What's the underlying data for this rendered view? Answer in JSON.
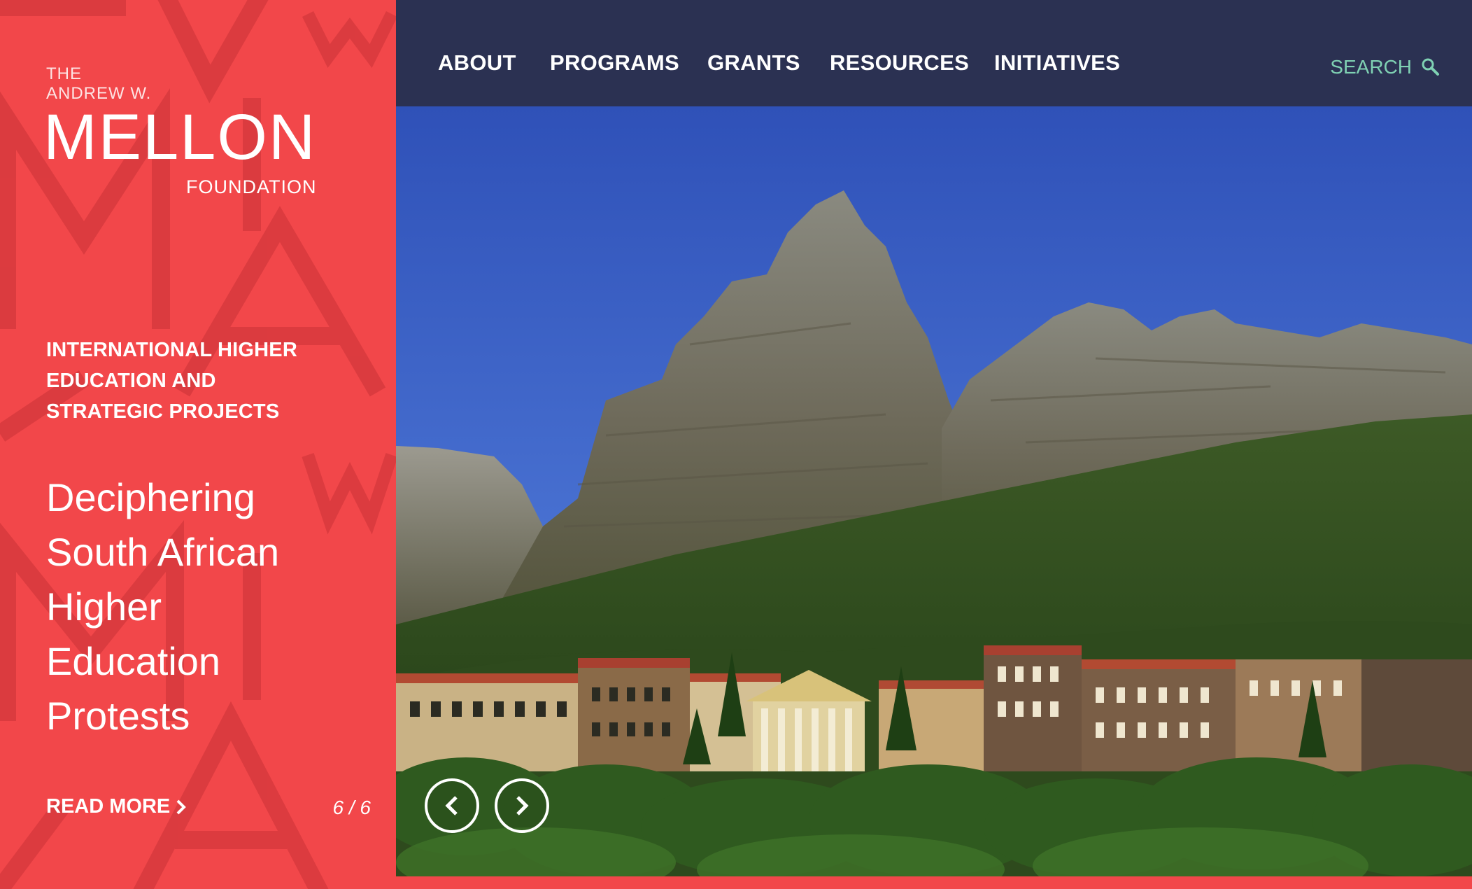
{
  "brand": {
    "line1": "THE",
    "line2": "ANDREW W.",
    "name": "MELLON",
    "line3": "FOUNDATION"
  },
  "nav": {
    "items": [
      "ABOUT",
      "PROGRAMS",
      "GRANTS",
      "RESOURCES",
      "INITIATIVES"
    ],
    "search_label": "SEARCH",
    "search_icon": "magnifier-icon"
  },
  "feature": {
    "category_lines": [
      "INTERNATIONAL HIGHER",
      "EDUCATION AND",
      "STRATEGIC PROJECTS"
    ],
    "headline_lines": [
      "Deciphering",
      "South African",
      "Higher",
      "Education",
      "Protests"
    ],
    "read_more": "READ MORE",
    "read_more_icon": "chevron-right-icon",
    "counter": "6 / 6"
  },
  "slider": {
    "prev_icon": "chevron-left-icon",
    "next_icon": "chevron-right-icon"
  },
  "colors": {
    "brand_red": "#f2474a",
    "nav_navy": "#2b3152",
    "search_green": "#7fd1b3"
  }
}
